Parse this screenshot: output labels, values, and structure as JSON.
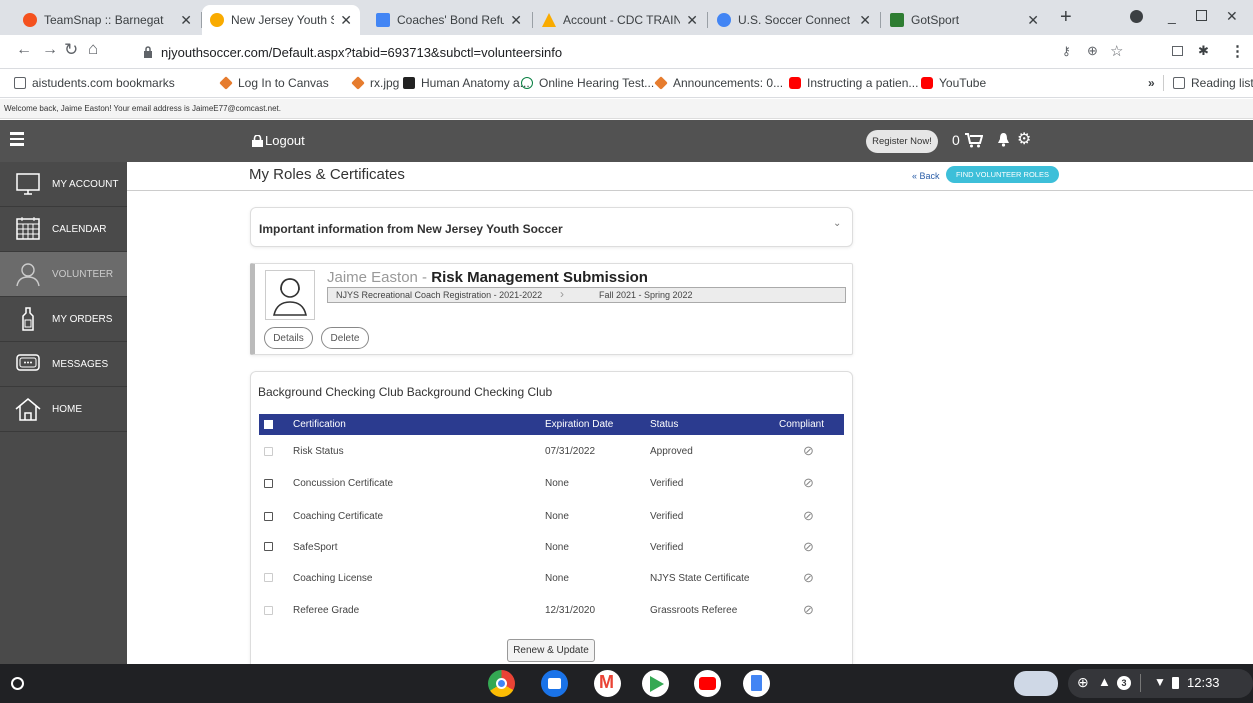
{
  "tabs": [
    {
      "title": "TeamSnap :: Barnegat",
      "color": "#f4511e"
    },
    {
      "title": "New Jersey Youth Socc",
      "color": "#f9ab00"
    },
    {
      "title": "Coaches' Bond Refund",
      "color": "#4285f4"
    },
    {
      "title": "Account - CDC TRAIN -",
      "color": "#f9ab00"
    },
    {
      "title": "U.S. Soccer Connect",
      "color": "#4285f4"
    },
    {
      "title": "GotSport",
      "color": "#2e7d32"
    }
  ],
  "address": {
    "url": "njyouthsoccer.com/Default.aspx?tabid=693713&subctl=volunteersinfo"
  },
  "bookmarks": [
    "aistudents.com bookmarks",
    "Log In to Canvas",
    "rx.jpg",
    "Human Anatomy a...",
    "Online Hearing Test...",
    "Announcements: 0...",
    "Instructing a patien...",
    "YouTube"
  ],
  "reading_list": "Reading list",
  "welcome": "Welcome back, Jaime Easton! Your email address is JaimeE77@comcast.net.",
  "topnav": {
    "logout": "Logout",
    "register": "Register Now!",
    "cart_count": "0"
  },
  "sidebar": [
    {
      "label": "MY ACCOUNT",
      "icon": "monitor-icon"
    },
    {
      "label": "CALENDAR",
      "icon": "calendar-icon"
    },
    {
      "label": "VOLUNTEER",
      "icon": "person-icon"
    },
    {
      "label": "MY ORDERS",
      "icon": "bottle-icon"
    },
    {
      "label": "MESSAGES",
      "icon": "chat-icon"
    },
    {
      "label": "HOME",
      "icon": "home-icon"
    }
  ],
  "page": {
    "title": "My Roles & Certificates",
    "back": "« Back",
    "find": "FIND VOLUNTEER ROLES",
    "important": "Important information from New Jersey Youth Soccer"
  },
  "role": {
    "name": "Jaime Easton",
    "separator": " - ",
    "title": "Risk Management Submission",
    "registration": "NJYS Recreational Coach Registration - 2021-2022",
    "season": "Fall 2021 - Spring 2022",
    "details": "Details",
    "delete": "Delete"
  },
  "background": {
    "title": "Background Checking Club Background Checking Club",
    "columns": [
      "Certification",
      "Expiration Date",
      "Status",
      "Compliant"
    ],
    "rows": [
      {
        "cert": "Risk Status",
        "exp": "07/31/2022",
        "status": "Approved",
        "enabled": false
      },
      {
        "cert": "Concussion Certificate",
        "exp": "None",
        "status": "Verified",
        "enabled": true
      },
      {
        "cert": "Coaching Certificate",
        "exp": "None",
        "status": "Verified",
        "enabled": true
      },
      {
        "cert": "SafeSport",
        "exp": "None",
        "status": "Verified",
        "enabled": true
      },
      {
        "cert": "Coaching License",
        "exp": "None",
        "status": "NJYS State Certificate",
        "enabled": false
      },
      {
        "cert": "Referee Grade",
        "exp": "12/31/2020",
        "status": "Grassroots Referee",
        "enabled": false
      }
    ],
    "renew": "Renew & Update"
  },
  "taskbar": {
    "time": "12:33",
    "badge": "3"
  }
}
